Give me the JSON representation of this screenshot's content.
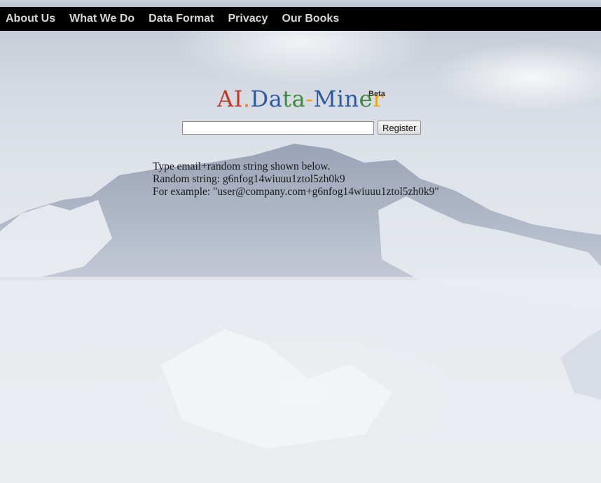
{
  "nav": {
    "items": [
      "About Us",
      "What We Do",
      "Data Format",
      "Privacy",
      "Our Books"
    ]
  },
  "logo": {
    "letters": [
      {
        "ch": "A",
        "color": "#c0392b"
      },
      {
        "ch": "I",
        "color": "#c0392b"
      },
      {
        "ch": ".",
        "color": "#e67e22"
      },
      {
        "ch": "D",
        "color": "#2c5aa0"
      },
      {
        "ch": "a",
        "color": "#2c5aa0"
      },
      {
        "ch": "t",
        "color": "#3a8a3a"
      },
      {
        "ch": "a",
        "color": "#3a8a3a"
      },
      {
        "ch": "-",
        "color": "#e6a817"
      },
      {
        "ch": "M",
        "color": "#2c5aa0"
      },
      {
        "ch": "i",
        "color": "#2c5aa0"
      },
      {
        "ch": "n",
        "color": "#2c5aa0"
      },
      {
        "ch": "e",
        "color": "#3a8a3a"
      },
      {
        "ch": "r",
        "color": "#e6a817"
      }
    ],
    "badge": "Beta"
  },
  "form": {
    "email_value": "",
    "register_label": "Register"
  },
  "info": {
    "line1": "Type email+random string shown below.",
    "line2": "Random string: g6nfog14wiuuu1ztol5zh0k9",
    "line3": "For example: \"user@company.com+g6nfog14wiuuu1ztol5zh0k9\""
  }
}
